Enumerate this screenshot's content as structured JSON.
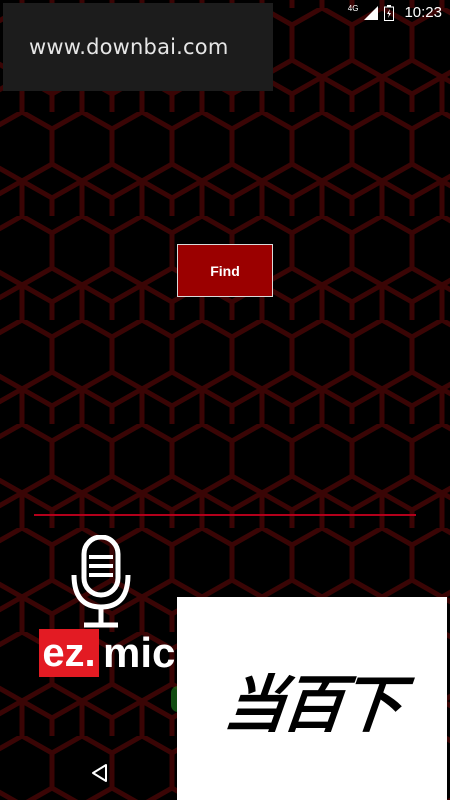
{
  "status_bar": {
    "network": "4G",
    "time": "10:23"
  },
  "watermark_top": {
    "text": "www.downbai.com"
  },
  "main": {
    "find_button_label": "Find"
  },
  "logo": {
    "ez": "ez.",
    "mic": "mic"
  },
  "watermark_bottom": {
    "text": "当百下"
  },
  "colors": {
    "background": "#000000",
    "hex_pattern": "#3a0505",
    "button": "#9b0000",
    "divider": "#b3001b",
    "logo_red": "#e31b23"
  },
  "icons": [
    "signal-icon",
    "battery-icon",
    "microphone-icon",
    "back-icon"
  ]
}
